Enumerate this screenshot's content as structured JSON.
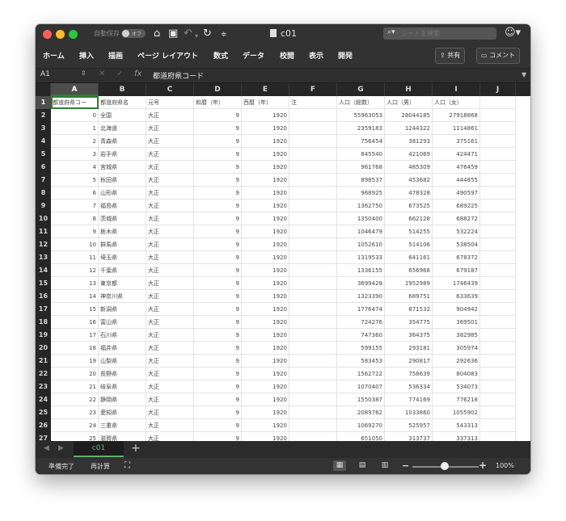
{
  "titlebar": {
    "autosave_label": "自動保存",
    "autosave_state": "オフ",
    "doc_title": "c01",
    "search_placeholder": "シートを検索",
    "icons": [
      "home-icon",
      "save-icon",
      "undo-icon",
      "redo-icon",
      "customize-icon",
      "document-icon",
      "search-icon",
      "smiley-icon"
    ],
    "light_colors": {
      "close": "#ff5f57",
      "minimize": "#febc2e",
      "zoom": "#28c840"
    }
  },
  "ribbon": {
    "tabs": [
      "ホーム",
      "挿入",
      "描画",
      "ページ レイアウト",
      "数式",
      "データ",
      "校閲",
      "表示",
      "開発"
    ],
    "share_label": "共有",
    "comment_label": "コメント"
  },
  "formula_bar": {
    "name_box": "A1",
    "fx_label": "fx",
    "content": "都道府県コード"
  },
  "sheet": {
    "active_cell": "A1",
    "columns": [
      "A",
      "B",
      "C",
      "D",
      "E",
      "F",
      "G",
      "H",
      "I",
      "J"
    ],
    "row_numbers": [
      "1",
      "2",
      "3",
      "4",
      "5",
      "6",
      "7",
      "8",
      "9",
      "10",
      "11",
      "12",
      "13",
      "14",
      "15",
      "16",
      "17",
      "18",
      "19",
      "20",
      "21",
      "22",
      "23",
      "24",
      "25",
      "26",
      "27"
    ],
    "header_row": [
      "都道府県コー",
      "都道府県名",
      "元号",
      "和暦（年）",
      "西暦（年）",
      "注",
      "人口（総数）",
      "人口（男）",
      "人口（女）",
      ""
    ],
    "rows": [
      [
        "0",
        "全国",
        "大正",
        "9",
        "1920",
        "",
        "55963053",
        "28044185",
        "27918868",
        ""
      ],
      [
        "1",
        "北海道",
        "大正",
        "9",
        "1920",
        "",
        "2359183",
        "1244322",
        "1114861",
        ""
      ],
      [
        "2",
        "青森県",
        "大正",
        "9",
        "1920",
        "",
        "756454",
        "381293",
        "375161",
        ""
      ],
      [
        "3",
        "岩手県",
        "大正",
        "9",
        "1920",
        "",
        "845540",
        "421069",
        "424471",
        ""
      ],
      [
        "4",
        "宮城県",
        "大正",
        "9",
        "1920",
        "",
        "961768",
        "485309",
        "476459",
        ""
      ],
      [
        "5",
        "秋田県",
        "大正",
        "9",
        "1920",
        "",
        "898537",
        "453682",
        "444855",
        ""
      ],
      [
        "6",
        "山形県",
        "大正",
        "9",
        "1920",
        "",
        "968925",
        "478328",
        "490597",
        ""
      ],
      [
        "7",
        "福島県",
        "大正",
        "9",
        "1920",
        "",
        "1362750",
        "673525",
        "689225",
        ""
      ],
      [
        "8",
        "茨城県",
        "大正",
        "9",
        "1920",
        "",
        "1350400",
        "662128",
        "688272",
        ""
      ],
      [
        "9",
        "栃木県",
        "大正",
        "9",
        "1920",
        "",
        "1046479",
        "514255",
        "532224",
        ""
      ],
      [
        "10",
        "群馬県",
        "大正",
        "9",
        "1920",
        "",
        "1052610",
        "514106",
        "538504",
        ""
      ],
      [
        "11",
        "埼玉県",
        "大正",
        "9",
        "1920",
        "",
        "1319533",
        "641161",
        "678372",
        ""
      ],
      [
        "12",
        "千葉県",
        "大正",
        "9",
        "1920",
        "",
        "1336155",
        "656968",
        "679187",
        ""
      ],
      [
        "13",
        "東京都",
        "大正",
        "9",
        "1920",
        "",
        "3699428",
        "1952989",
        "1746439",
        ""
      ],
      [
        "14",
        "神奈川県",
        "大正",
        "9",
        "1920",
        "",
        "1323390",
        "689751",
        "633639",
        ""
      ],
      [
        "15",
        "新潟県",
        "大正",
        "9",
        "1920",
        "",
        "1776474",
        "871532",
        "904942",
        ""
      ],
      [
        "16",
        "富山県",
        "大正",
        "9",
        "1920",
        "",
        "724276",
        "354775",
        "369501",
        ""
      ],
      [
        "17",
        "石川県",
        "大正",
        "9",
        "1920",
        "",
        "747360",
        "364375",
        "382985",
        ""
      ],
      [
        "18",
        "福井県",
        "大正",
        "9",
        "1920",
        "",
        "599155",
        "293181",
        "305974",
        ""
      ],
      [
        "19",
        "山梨県",
        "大正",
        "9",
        "1920",
        "",
        "583453",
        "290817",
        "292636",
        ""
      ],
      [
        "20",
        "長野県",
        "大正",
        "9",
        "1920",
        "",
        "1562722",
        "758639",
        "804083",
        ""
      ],
      [
        "21",
        "岐阜県",
        "大正",
        "9",
        "1920",
        "",
        "1070407",
        "536334",
        "534073",
        ""
      ],
      [
        "22",
        "静岡県",
        "大正",
        "9",
        "1920",
        "",
        "1550387",
        "774169",
        "776218",
        ""
      ],
      [
        "23",
        "愛知県",
        "大正",
        "9",
        "1920",
        "",
        "2089762",
        "1033860",
        "1055902",
        ""
      ],
      [
        "24",
        "三重県",
        "大正",
        "9",
        "1920",
        "",
        "1069270",
        "525957",
        "543313",
        ""
      ],
      [
        "25",
        "滋賀県",
        "大正",
        "9",
        "1920",
        "",
        "651050",
        "313737",
        "337313",
        ""
      ]
    ]
  },
  "sheet_tabs": {
    "active": "c01",
    "add_label": "+"
  },
  "status": {
    "ready": "準備完了",
    "recalc": "再計算",
    "zoom": "100%",
    "zoom_minus": "−",
    "zoom_plus": "+",
    "zoom_level": 1.0
  }
}
